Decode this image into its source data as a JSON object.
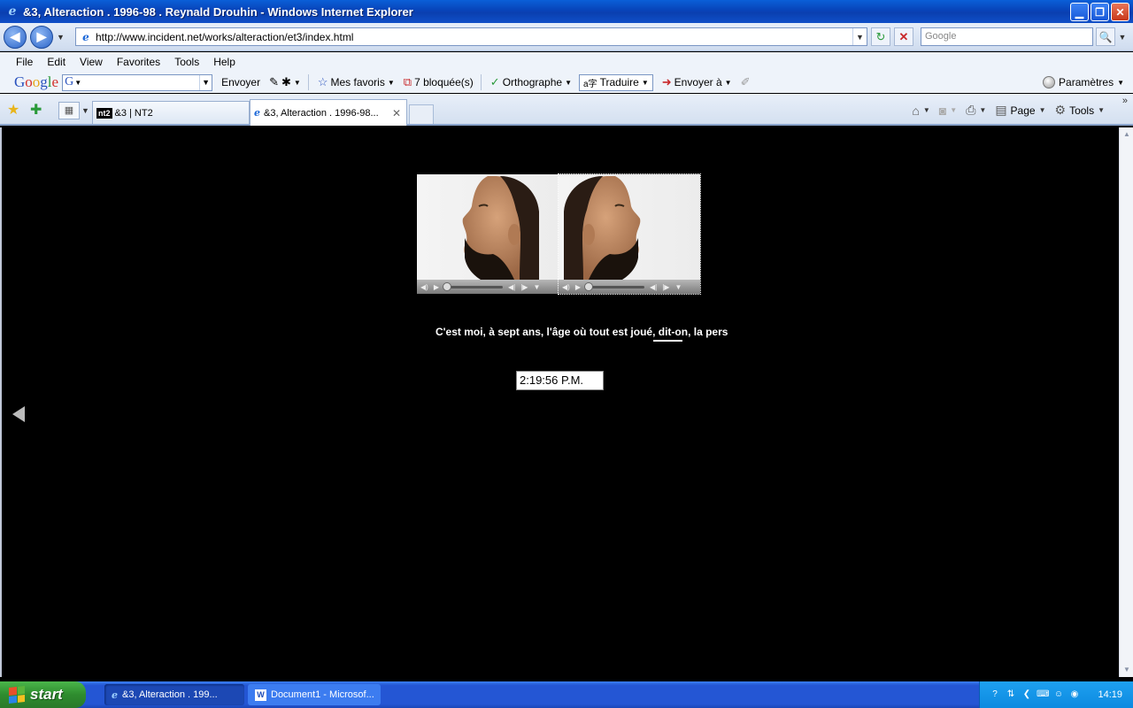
{
  "window": {
    "title": "&3, Alteraction . 1996-98 . Reynald Drouhin - Windows Internet Explorer",
    "minimize_glyph": "▁",
    "maximize_glyph": "❐",
    "close_glyph": "✕"
  },
  "address_bar": {
    "url": "http://www.incident.net/works/alteraction/et3/index.html",
    "search_placeholder": "Google",
    "back_glyph": "◀",
    "forward_glyph": "▶",
    "refresh_glyph": "↻",
    "stop_glyph": "✕",
    "search_go_glyph": "🔍"
  },
  "menu": [
    "File",
    "Edit",
    "View",
    "Favorites",
    "Tools",
    "Help"
  ],
  "google_toolbar": {
    "logo": [
      "G",
      "o",
      "o",
      "g",
      "l",
      "e"
    ],
    "search_prefix": "G",
    "envoyer": "Envoyer",
    "mes_favoris": "Mes favoris",
    "bloquees": "7 bloquée(s)",
    "orthographe": "Orthographe",
    "traduire": "Traduire",
    "envoyer_a": "Envoyer à",
    "parametres": "Paramètres"
  },
  "tabs": [
    {
      "label": "&3 | NT2",
      "badge": "nt2",
      "active": false
    },
    {
      "label": "&3, Alteraction . 1996-98...",
      "active": true
    }
  ],
  "command_bar": {
    "page": "Page",
    "tools": "Tools"
  },
  "content": {
    "poem_text": "C'est moi, à sept ans, l'âge où tout est joué, dit-on, la person",
    "clock_value": "2:19:56 P.M."
  },
  "taskbar": {
    "start": "start",
    "tasks": [
      {
        "label": "&3, Alteraction . 199...",
        "icon": "ie-icon"
      },
      {
        "label": "Document1 - Microsof...",
        "icon": "word-icon"
      }
    ],
    "time": "14:19"
  },
  "colors": {
    "titlebar": "#0843b8",
    "page_background": "#000000",
    "taskbar": "#2456d4",
    "start_button": "#2e8c2e"
  }
}
